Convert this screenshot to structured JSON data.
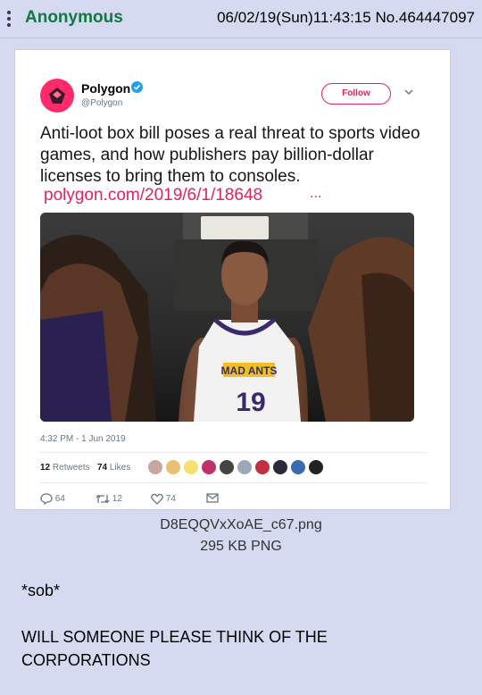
{
  "post": {
    "name": "Anonymous",
    "datetime": "06/02/19(Sun)11:43:15",
    "number": "No.464447097",
    "file_name": "D8EQQVxXoAE_c67.png",
    "file_size": "295 KB PNG",
    "comment": [
      "*sob*",
      "WILL SOMEONE PLEASE THINK OF THE",
      "CORPORATIONS"
    ]
  },
  "tweet": {
    "account_name": "Polygon",
    "handle": "@Polygon",
    "follow_label": "Follow",
    "text": "Anti-loot box bill poses a real threat to sports video games, and how publishers pay billion-dollar licenses to bring them to consoles.",
    "link": "polygon.com/2019/6/1/18648",
    "link_ellipsis": "...",
    "jersey_team": "MAD ANTS",
    "jersey_number": "19",
    "timestamp": "4:32 PM - 1 Jun 2019",
    "retweets_count": "12",
    "retweets_label": "Retweets",
    "likes_count": "74",
    "likes_label": "Likes",
    "reply_count": "64",
    "retweet_action_count": "12",
    "like_action_count": "74"
  },
  "colors": {
    "board_bg": "#d6daf0",
    "name_green": "#117743",
    "polygon_pink": "#e0245e",
    "verified_blue": "#1da1f2"
  },
  "icons": [
    "menu-dots-icon",
    "verified-icon",
    "chevron-down-icon",
    "reply-icon",
    "retweet-icon",
    "like-icon",
    "message-icon"
  ]
}
